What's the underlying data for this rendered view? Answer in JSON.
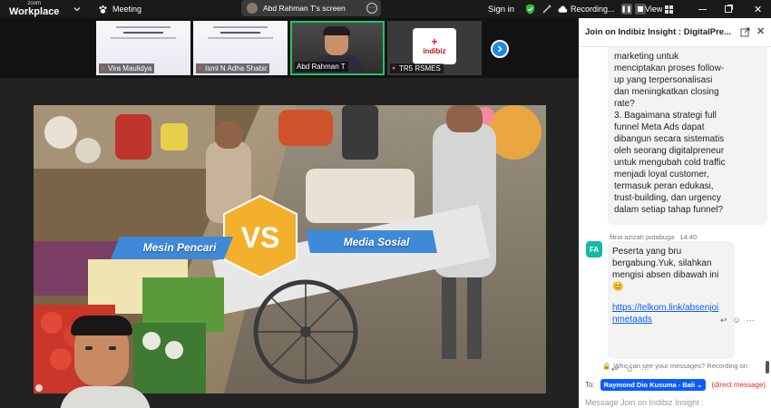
{
  "app": {
    "logo_small": "zoom",
    "logo_big": "Workplace"
  },
  "topbar": {
    "meeting_label": "Meeting",
    "share_label": "Abd Rahman T's screen",
    "signin_label": "Sign in",
    "recording_label": "Recording...",
    "view_label": "View"
  },
  "participants": [
    {
      "name": "Vira Maulidya"
    },
    {
      "name": "Isml N Adha Shabir"
    },
    {
      "name": "Abd Rahman T"
    },
    {
      "name": "TR5 RSMES"
    }
  ],
  "tile_brand": "indibiz",
  "slide": {
    "left_label": "Mesin Pencari",
    "vs": "VS",
    "right_label": "Media Sosial"
  },
  "chat": {
    "title": "Join on Indibiz Insight : DigitalPre...",
    "prev_message_lines": [
      "marketing untuk",
      "menciptakan proses follow-",
      "up yang terpersonalisasi",
      "dan meningkatkan closing",
      "rate?",
      "3. Bagaimana strategi full",
      "funnel Meta Ads dapat",
      "dibangun secara sistematis",
      "oleh seorang digitalpreneur",
      "untuk mengubah cold traffic",
      "menjadi loyal customer,",
      "termasuk peran edukasi,",
      "trust-building, dan urgency",
      "dalam setiap tahap funnel?"
    ],
    "sender_name": "fitria azizah potabuga",
    "sender_time": "14:40",
    "sender_initials": "FA",
    "message_lines": [
      "Peserta yang bru",
      "bergabung.Yuk, silahkan",
      "mengisi absen dibawah ini"
    ],
    "message_emoji": "😊",
    "link_lines": [
      "https://telkom.link/absenjoi",
      "nmetaads"
    ],
    "who_can_see": "Who can see your messages? Recording on",
    "to_label": "To:",
    "recipient": "Raymond Dio Kusuma - Bali",
    "direct_label": "(direct message)",
    "input_placeholder": "Message Join on Indibiz Insight :"
  }
}
